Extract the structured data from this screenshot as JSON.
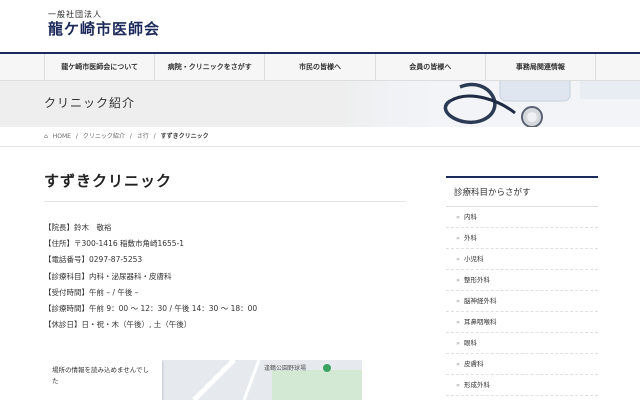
{
  "header": {
    "logo_sub": "一般社団法人",
    "logo_main": "龍ケ崎市医師会"
  },
  "nav": [
    {
      "label": "龍ケ崎市医師会について"
    },
    {
      "label": "病院・クリニックをさがす"
    },
    {
      "label": "市民の皆様へ"
    },
    {
      "label": "会員の皆様へ"
    },
    {
      "label": "事務局関連情報"
    }
  ],
  "hero": {
    "title": "クリニック紹介"
  },
  "breadcrumb": {
    "home_icon": "home-icon",
    "home": "HOME",
    "sep": "/",
    "items": [
      "クリニック紹介",
      "さ行"
    ],
    "current": "すずきクリニック"
  },
  "clinic": {
    "name": "すずきクリニック",
    "lines": [
      "【院長】鈴木　敬裕",
      "【住所】〒300-1416 稲敷市角崎1655-1",
      "【電話番号】0297-87-5253",
      "【診療科目】内科・泌尿器科・皮膚科",
      "【受付時間】午前 – / 午後 –",
      "【診療時間】午前 9：00 〜 12：30 / 午後 14：30 〜 18：00",
      "【休診日】日・祝・木（午後）, 土（午後）"
    ]
  },
  "map": {
    "message": "場所の情報を読み込めませんでした",
    "label": "逢鶴公園野球場"
  },
  "sidebar": {
    "title": "診療科目からさがす",
    "bullet": "»",
    "items": [
      "内科",
      "外科",
      "小児科",
      "整形外科",
      "脳神経外科",
      "耳鼻咽喉科",
      "眼科",
      "皮膚科",
      "形成外科"
    ]
  },
  "colors": {
    "brand_navy": "#1c2a5a",
    "nav_bg": "#f6f6f6",
    "hero_bg": "#eeeeee"
  }
}
